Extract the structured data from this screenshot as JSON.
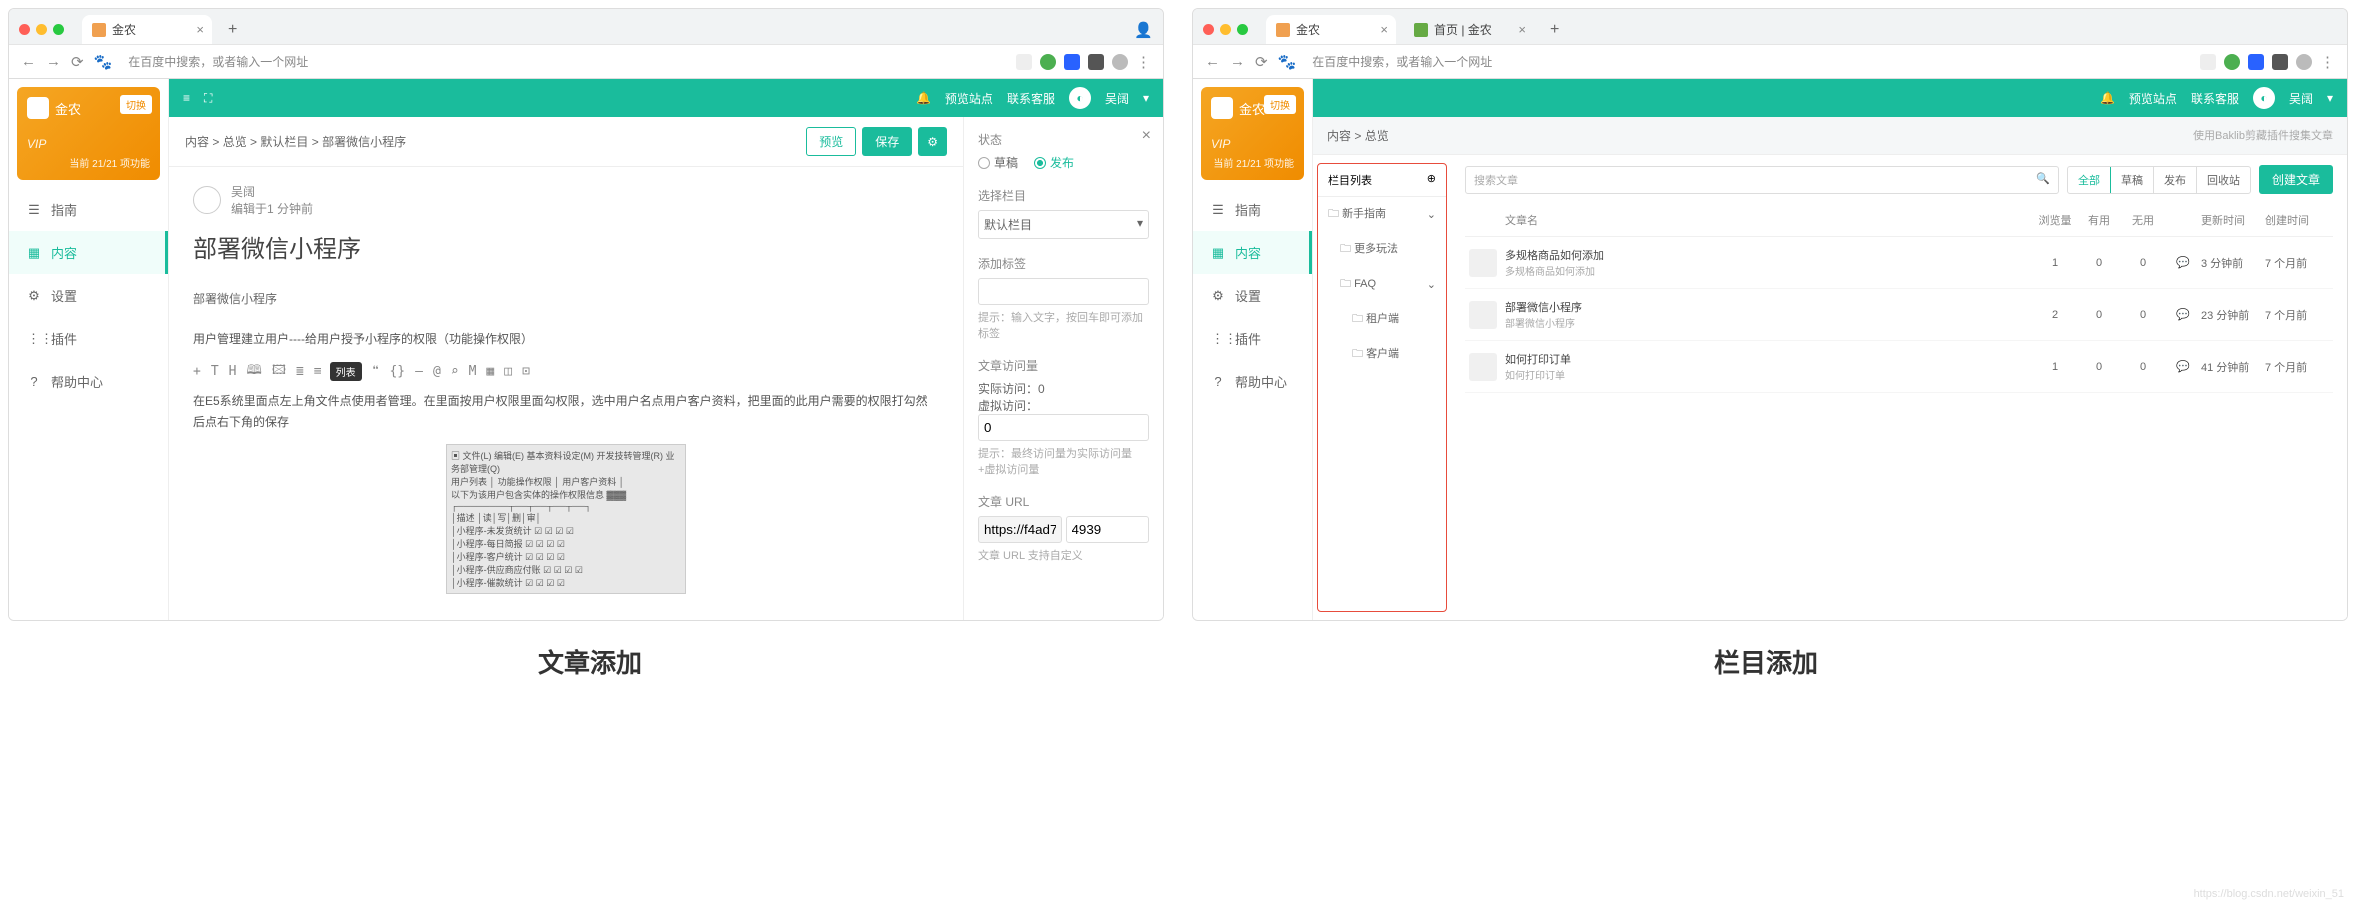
{
  "left": {
    "tab_title": "金农",
    "address_placeholder": "在百度中搜索，或者输入一个网址",
    "vip": {
      "name": "金农",
      "switch": "切换",
      "badge": "VIP",
      "quota": "当前 21/21 项功能"
    },
    "nav": [
      {
        "icon": "☰",
        "label": "指南"
      },
      {
        "icon": "▦",
        "label": "内容",
        "active": true
      },
      {
        "icon": "⚙",
        "label": "设置"
      },
      {
        "icon": "⋮⋮",
        "label": "插件"
      },
      {
        "icon": "?",
        "label": "帮助中心"
      }
    ],
    "topbar": {
      "preview": "预览站点",
      "contact": "联系客服",
      "user": "吴阔",
      "bell": "🔔"
    },
    "crumb": {
      "a": "内容",
      "b": "总览",
      "c": "默认栏目",
      "d": "部署微信小程序",
      "preview": "预览",
      "save": "保存"
    },
    "editor": {
      "author": "吴阔",
      "edited": "编辑于1 分钟前",
      "title": "部署微信小程序",
      "subtitle": "部署微信小程序",
      "p1": "用户管理建立用户----给用户授予小程序的权限（功能操作权限）",
      "p2": "在E5系统里面点左上角文件点使用者管理。在里面按用户权限里面勾权限，选中用户名点用户客户资料，把里面的此用户需要的权限打勾然后点右下角的保存",
      "tooltip": "列表",
      "tools": [
        "+",
        "T",
        "H",
        "🕮",
        "🖾",
        "≣",
        "≡",
        "❝",
        "{}",
        "—",
        "@",
        "⌕",
        "M",
        "▦",
        "◫",
        "⊡"
      ]
    },
    "side": {
      "status_label": "状态",
      "draft": "草稿",
      "publish": "发布",
      "col_label": "选择栏目",
      "col_value": "默认栏目",
      "tag_label": "添加标签",
      "tag_hint": "提示：输入文字，按回车即可添加标签",
      "visits_label": "文章访问量",
      "real": "实际访问：0",
      "virt_label": "虚拟访问：",
      "virt_val": "0",
      "visit_hint": "提示：最终访问量为实际访问量+虚拟访问量",
      "url_label": "文章 URL",
      "url_base": "https://f4ad7",
      "url_id": "4939",
      "url_hint": "文章 URL 支持自定义"
    }
  },
  "right": {
    "tabs": [
      {
        "t": "金农"
      },
      {
        "t": "首页 | 金农"
      }
    ],
    "address_placeholder": "在百度中搜索，或者输入一个网址",
    "vip": {
      "name": "金农",
      "switch": "切换",
      "badge": "VIP",
      "quota": "当前 21/21 项功能"
    },
    "nav": [
      {
        "icon": "☰",
        "label": "指南"
      },
      {
        "icon": "▦",
        "label": "内容",
        "active": true
      },
      {
        "icon": "⚙",
        "label": "设置"
      },
      {
        "icon": "⋮⋮",
        "label": "插件"
      },
      {
        "icon": "?",
        "label": "帮助中心"
      }
    ],
    "topbar": {
      "preview": "预览站点",
      "contact": "联系客服",
      "user": "吴阔"
    },
    "crumb": {
      "a": "内容",
      "b": "总览",
      "r": "使用Baklib剪藏插件搜集文章"
    },
    "col_panel": {
      "title": "栏目列表",
      "items": [
        {
          "label": "新手指南",
          "icon": "🗀",
          "exp": true
        },
        {
          "label": "更多玩法",
          "icon": "🗀",
          "sub": true
        },
        {
          "label": "FAQ",
          "icon": "🗀",
          "sub": true,
          "exp": true
        },
        {
          "label": "租户端",
          "icon": "🗀",
          "sub": true,
          "deep": true
        },
        {
          "label": "客户端",
          "icon": "🗀",
          "sub": true,
          "deep": true
        }
      ]
    },
    "list": {
      "search_ph": "搜索文章",
      "filters": [
        "全部",
        "草稿",
        "发布",
        "回收站"
      ],
      "create": "创建文章",
      "cols": [
        "文章名",
        "浏览量",
        "有用",
        "无用",
        "更新时间",
        "创建时间"
      ],
      "rows": [
        {
          "t": "多规格商品如何添加",
          "s": "多规格商品如何添加",
          "v": 1,
          "y": 0,
          "n": 0,
          "u": "3 分钟前",
          "c": "7 个月前"
        },
        {
          "t": "部署微信小程序",
          "s": "部署微信小程序",
          "v": 2,
          "y": 0,
          "n": 0,
          "u": "23 分钟前",
          "c": "7 个月前"
        },
        {
          "t": "如何打印订单",
          "s": "如何打印订单",
          "v": 1,
          "y": 0,
          "n": 0,
          "u": "41 分钟前",
          "c": "7 个月前"
        }
      ]
    }
  },
  "captions": {
    "left": "文章添加",
    "right": "栏目添加"
  },
  "watermark": "https://blog.csdn.net/weixin_51"
}
